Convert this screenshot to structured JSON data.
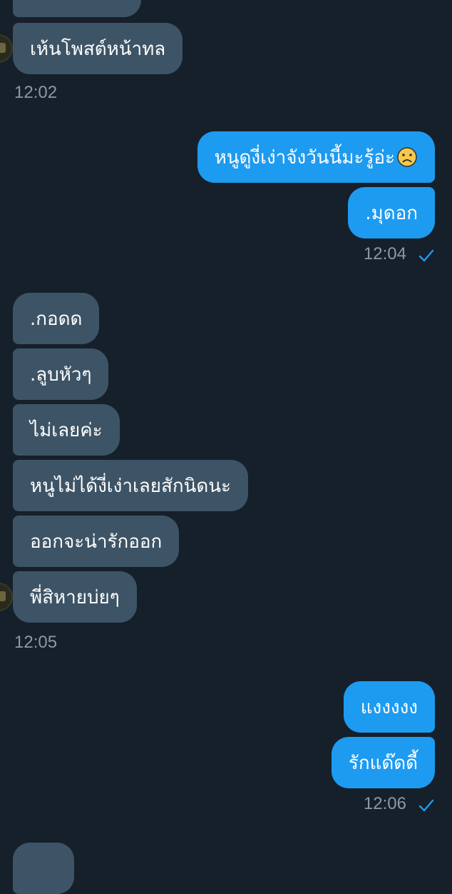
{
  "conversation": {
    "messages": [
      {
        "id": "m0",
        "direction": "incoming",
        "text": ""
      },
      {
        "id": "m1",
        "direction": "incoming",
        "text": "เห้นโพสต์หน้าทล"
      },
      {
        "id": "m2",
        "direction": "outgoing",
        "text": "หนูดูงี่เง่าจังวันนี้มะรู้อ่ะ",
        "emoji": "frowning-face"
      },
      {
        "id": "m3",
        "direction": "outgoing",
        "text": ".มุดอก"
      },
      {
        "id": "m4",
        "direction": "incoming",
        "text": ".กอดด"
      },
      {
        "id": "m5",
        "direction": "incoming",
        "text": ".ลูบหัวๆ"
      },
      {
        "id": "m6",
        "direction": "incoming",
        "text": "ไม่เลยค่ะ"
      },
      {
        "id": "m7",
        "direction": "incoming",
        "text": "หนูไม่ได้งี่เง่าเลยสักนิดนะ"
      },
      {
        "id": "m8",
        "direction": "incoming",
        "text": "ออกจะน่ารักออก"
      },
      {
        "id": "m9",
        "direction": "incoming",
        "text": "พี่สิหายบ่ยๆ"
      },
      {
        "id": "m10",
        "direction": "outgoing",
        "text": "แงงงงง"
      },
      {
        "id": "m11",
        "direction": "outgoing",
        "text": "รักแด๊ดดี้"
      },
      {
        "id": "m12",
        "direction": "incoming",
        "text": ""
      }
    ],
    "timestamps": {
      "t1": "12:02",
      "t2": "12:04",
      "t3": "12:05",
      "t4": "12:06"
    }
  },
  "colors": {
    "background": "#15202b",
    "incoming_bubble": "#3d5466",
    "outgoing_bubble": "#1d9bf0",
    "timestamp": "#8b98a5",
    "read_check": "#1d9bf0"
  },
  "icons": {
    "read_receipt": "check-icon",
    "emoji": "frowning-face-icon",
    "avatar": "avatar"
  }
}
